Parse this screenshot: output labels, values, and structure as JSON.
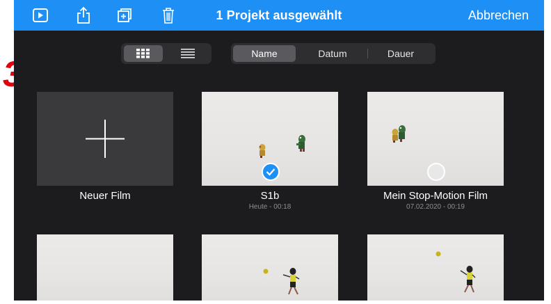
{
  "toolbar": {
    "title": "1 Projekt ausgewählt",
    "cancel_label": "Abbrechen",
    "icons": [
      "play-icon",
      "share-icon",
      "duplicate-icon",
      "trash-icon"
    ]
  },
  "annotation": {
    "step_number": "3",
    "color": "#e3000f"
  },
  "view_toggle": {
    "selected": "grid",
    "options": [
      "grid",
      "list"
    ]
  },
  "sort": {
    "selected": "Name",
    "options": [
      "Name",
      "Datum",
      "Dauer"
    ]
  },
  "projects": [
    {
      "title": "Neuer Film",
      "subtitle": "",
      "kind": "new"
    },
    {
      "title": "S1b",
      "subtitle": "Heute - 00:18",
      "kind": "project",
      "selected": true
    },
    {
      "title": "Mein Stop-Motion Film",
      "subtitle": "07.02.2020 - 00:19",
      "kind": "project",
      "selected": false
    },
    {
      "title": "",
      "subtitle": "",
      "kind": "project"
    },
    {
      "title": "",
      "subtitle": "",
      "kind": "project"
    },
    {
      "title": "",
      "subtitle": "",
      "kind": "project"
    }
  ],
  "colors": {
    "accent": "#1e90f5",
    "background": "#1c1c1e"
  }
}
